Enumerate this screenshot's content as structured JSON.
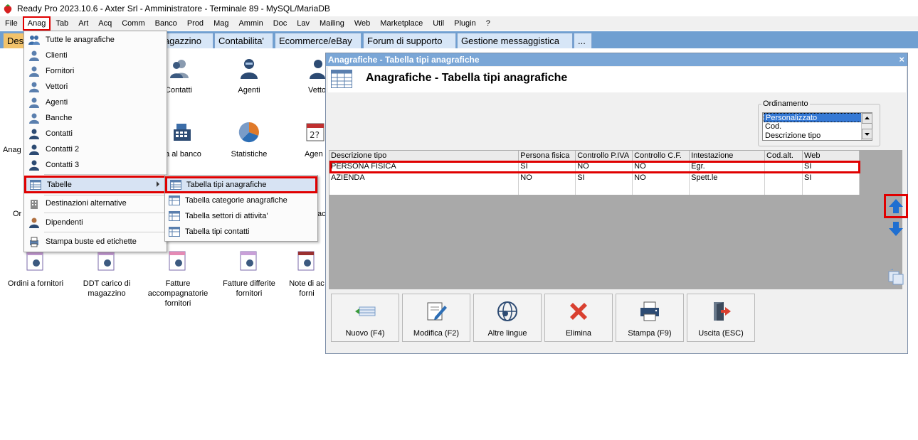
{
  "window": {
    "title": "Ready Pro 2023.10.6 - Axter Srl - Amministratore - Terminale 89 - MySQL/MariaDB"
  },
  "menubar": {
    "items": [
      "File",
      "Anag",
      "Tab",
      "Art",
      "Acq",
      "Comm",
      "Banco",
      "Prod",
      "Mag",
      "Ammin",
      "Doc",
      "Lav",
      "Mailing",
      "Web",
      "Marketplace",
      "Util",
      "Plugin",
      "?"
    ]
  },
  "tabs": {
    "items": [
      "Des",
      "lagazzino",
      "Contabilita'",
      "Ecommerce/eBay",
      "Forum di supporto",
      "Gestione messaggistica",
      "..."
    ]
  },
  "launcher": {
    "row1": [
      "Contatti",
      "Agenti",
      "Vetto"
    ],
    "row2": [
      "ta al banco",
      "Statistiche",
      "Agen"
    ],
    "partial_left_1": "Anag",
    "partial_left_2": "Or",
    "partial_right_2": "ac",
    "row3": [
      "Ordini a fornitori",
      "DDT carico di magazzino",
      "Fatture accompagnatorie fornitori",
      "Fatture differite fornitori",
      "Note di ac forni"
    ]
  },
  "anag_menu": {
    "items": [
      "Tutte le anagrafiche",
      "Clienti",
      "Fornitori",
      "Vettori",
      "Agenti",
      "Banche",
      "Contatti",
      "Contatti 2",
      "Contatti 3",
      "Tabelle",
      "Destinazioni alternative",
      "Dipendenti",
      "Stampa buste ed etichette"
    ],
    "icons": [
      "users-icon",
      "client-icon",
      "supplier-icon",
      "carrier-icon",
      "agent-icon",
      "bank-icon",
      "contact-icon",
      "contact-icon",
      "contact-icon",
      "table-icon",
      "building-icon",
      "employee-icon",
      "printer-icon"
    ]
  },
  "tabelle_submenu": {
    "items": [
      "Tabella tipi anagrafiche",
      "Tabella categorie anagrafiche",
      "Tabella settori di attivita'",
      "Tabella tipi contatti"
    ]
  },
  "dialog": {
    "window_title": "Anagrafiche - Tabella tipi anagrafiche",
    "close_label": "×",
    "header_title": "Anagrafiche - Tabella tipi anagrafiche",
    "ordering": {
      "legend": "Ordinamento",
      "options": [
        "Personalizzato",
        "Cod.",
        "Descrizione tipo"
      ],
      "selected": "Personalizzato"
    },
    "grid": {
      "columns": [
        "Descrizione tipo",
        "Persona fisica",
        "Controllo P.IVA",
        "Controllo C.F.",
        "Intestazione",
        "Cod.alt.",
        "Web"
      ],
      "rows": [
        [
          "PERSONA FISICA",
          "SI",
          "NO",
          "NO",
          "Egr.",
          "",
          "SI"
        ],
        [
          "AZIENDA",
          "NO",
          "SI",
          "NO",
          "Spett.le",
          "",
          "SI"
        ]
      ]
    },
    "buttons": [
      "Nuovo (F4)",
      "Modifica (F2)",
      "Altre lingue",
      "Elimina",
      "Stampa (F9)",
      "Uscita (ESC)"
    ]
  },
  "colors": {
    "highlight_border": "#e00000",
    "tab_strip": "#6f9fd1",
    "dialog_title": "#7aa6d6",
    "move_arrow": "#1f6fd1"
  }
}
